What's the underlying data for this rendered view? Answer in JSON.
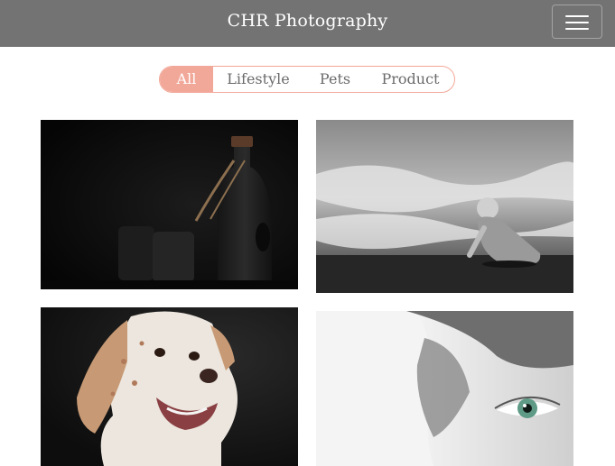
{
  "navbar": {
    "brand": "CHR Photography",
    "menu_icon": "hamburger-menu-icon"
  },
  "filters": [
    {
      "label": "All",
      "active": true
    },
    {
      "label": "Lifestyle",
      "active": false
    },
    {
      "label": "Pets",
      "active": false
    },
    {
      "label": "Product",
      "active": false
    }
  ],
  "colors": {
    "navbar_bg": "#737373",
    "accent": "#f2a899",
    "filter_text": "#6b6b6b"
  }
}
